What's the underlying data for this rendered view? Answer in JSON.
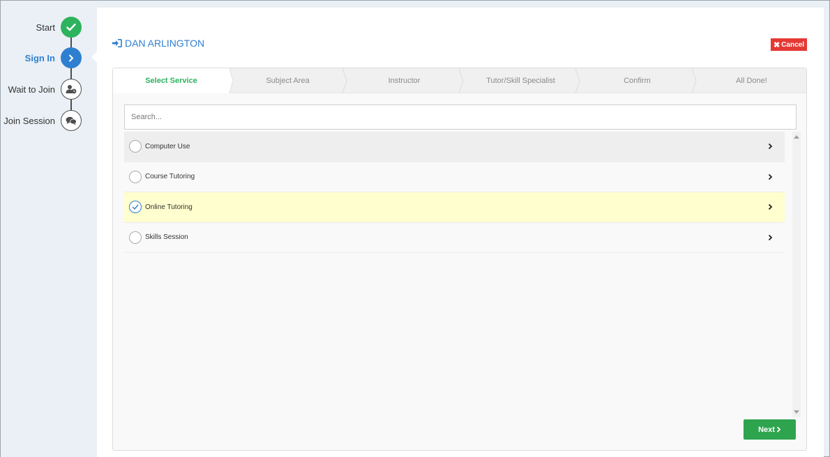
{
  "sidebar": {
    "steps": [
      {
        "label": "Start",
        "state": "done",
        "icon": "check-icon"
      },
      {
        "label": "Sign In",
        "state": "current",
        "icon": "chevron-right-icon"
      },
      {
        "label": "Wait to Join",
        "state": "pending",
        "icon": "user-clock-icon"
      },
      {
        "label": "Join Session",
        "state": "pending",
        "icon": "comments-icon"
      }
    ]
  },
  "header": {
    "user_name": "DAN ARLINGTON",
    "user_icon": "sign-in-icon",
    "cancel_label": "Cancel"
  },
  "wizard": {
    "tabs": [
      {
        "label": "Select Service",
        "active": true
      },
      {
        "label": "Subject Area",
        "active": false
      },
      {
        "label": "Instructor",
        "active": false
      },
      {
        "label": "Tutor/Skill Specialist",
        "active": false
      },
      {
        "label": "Confirm",
        "active": false
      },
      {
        "label": "All Done!",
        "active": false
      }
    ],
    "search_placeholder": "Search...",
    "search_value": "",
    "services": [
      {
        "label": "Computer Use",
        "checked": false,
        "state": "hover"
      },
      {
        "label": "Course Tutoring",
        "checked": false,
        "state": "normal"
      },
      {
        "label": "Online Tutoring",
        "checked": true,
        "state": "selected"
      },
      {
        "label": "Skills Session",
        "checked": false,
        "state": "normal"
      }
    ],
    "next_label": "Next"
  },
  "colors": {
    "accent_blue": "#2f7fd0",
    "accent_green": "#2db35d",
    "cancel_red": "#e53935",
    "selected_row": "#fefece"
  }
}
